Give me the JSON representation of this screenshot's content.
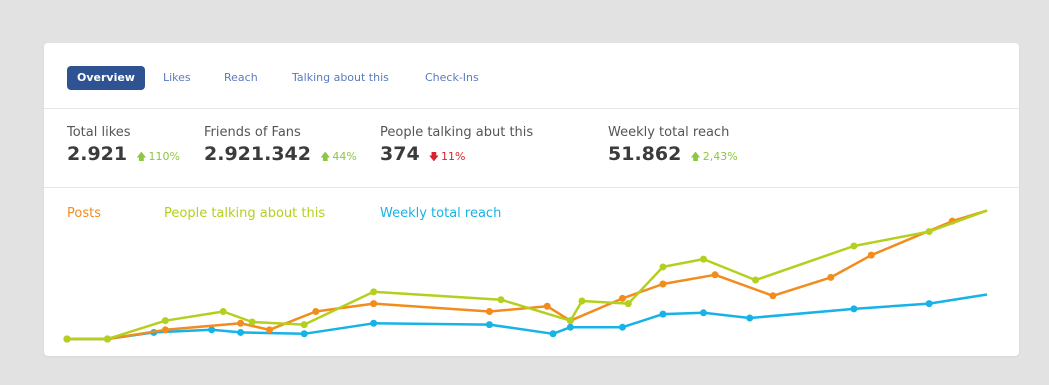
{
  "tabs": [
    {
      "label": "Overview",
      "active": true
    },
    {
      "label": "Likes"
    },
    {
      "label": "Reach"
    },
    {
      "label": "Talking about this"
    },
    {
      "label": "Check-Ins"
    }
  ],
  "stats": [
    {
      "label": "Total likes",
      "value": "2.921",
      "change": "110%",
      "direction": "up"
    },
    {
      "label": "Friends of Fans",
      "value": "2.921.342",
      "change": "44%",
      "direction": "up"
    },
    {
      "label": "People talking abut this",
      "value": "374",
      "change": "11%",
      "direction": "down"
    },
    {
      "label": "Weekly total reach",
      "value": "51.862",
      "change": "2,43%",
      "direction": "up"
    }
  ],
  "colors": {
    "posts": "#f28c1c",
    "talking": "#b5cf1f",
    "reach": "#17b3e6",
    "up": "#8dc63f",
    "down": "#d8232a",
    "active_tab": "#2f5293",
    "tab_text": "#5b7bbf"
  },
  "chart_data": {
    "type": "line",
    "x": [
      0,
      1,
      2,
      3,
      4,
      5,
      6,
      7,
      8,
      9,
      10,
      11,
      12,
      13,
      14,
      15,
      16,
      17,
      18,
      19
    ],
    "ylim": [
      0,
      100
    ],
    "grid": false,
    "legend_position": "top-left",
    "series": [
      {
        "name": "Posts",
        "color": "#f28c1c",
        "values": [
          0,
          0,
          7,
          12,
          7,
          21,
          27,
          21,
          25,
          14,
          31,
          42,
          49,
          33,
          47,
          64,
          90,
          98,
          null,
          null
        ]
      },
      {
        "name": "People talking about this",
        "values": [
          0,
          0,
          14,
          21,
          13,
          11,
          36,
          30,
          14,
          29,
          27,
          55,
          61,
          45,
          71,
          82,
          98,
          null,
          null,
          null
        ],
        "color": "#b5cf1f"
      },
      {
        "name": "Weekly total reach",
        "values": [
          0,
          0,
          5,
          7,
          5,
          4,
          12,
          11,
          4,
          9,
          9,
          19,
          20,
          16,
          23,
          27,
          34,
          null,
          null,
          null
        ],
        "color": "#17b3e6"
      }
    ],
    "x_raw": {
      "posts": [
        0,
        0.7,
        1.7,
        3,
        3.5,
        4.3,
        5.3,
        7.3,
        8.3,
        8.7,
        9.6,
        10.3,
        11.2,
        12.2,
        13.2,
        13.9,
        15.3,
        15.9
      ],
      "talking": [
        0,
        0.7,
        1.7,
        2.7,
        3.2,
        4.1,
        5.3,
        7.5,
        8.7,
        8.9,
        9.7,
        10.3,
        11.0,
        11.9,
        13.6,
        14.9,
        15.9
      ],
      "reach": [
        0,
        0.7,
        1.5,
        2.5,
        3.0,
        4.1,
        5.3,
        7.3,
        8.4,
        8.7,
        9.6,
        10.3,
        11.0,
        11.8,
        13.6,
        14.9,
        15.9
      ]
    }
  }
}
